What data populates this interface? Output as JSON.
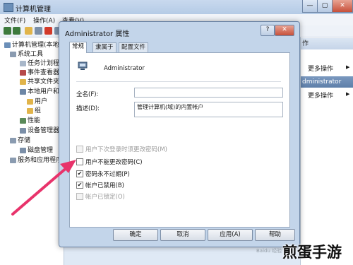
{
  "window": {
    "title": "计算机管理",
    "controls": {
      "minimize": "—",
      "maximize": "▢",
      "close": "✕"
    }
  },
  "menubar": {
    "items": [
      "文件(F)",
      "操作(A)",
      "查看(V)"
    ]
  },
  "tree": {
    "items": [
      {
        "label": "计算机管理(本地)"
      },
      {
        "label": "系统工具"
      },
      {
        "label": "任务计划程序"
      },
      {
        "label": "事件查看器"
      },
      {
        "label": "共享文件夹"
      },
      {
        "label": "本地用户和组"
      },
      {
        "label": "用户"
      },
      {
        "label": "组"
      },
      {
        "label": "性能"
      },
      {
        "label": "设备管理器"
      },
      {
        "label": "存储"
      },
      {
        "label": "磁盘管理"
      },
      {
        "label": "服务和应用程序"
      }
    ]
  },
  "actions": {
    "header1": "作",
    "more1": "更多操作",
    "header2": "dministrator",
    "more2": "更多操作"
  },
  "dialog": {
    "title": "Administrator 属性",
    "help_button": "?",
    "close_button": "✕",
    "tabs": [
      "常规",
      "隶属于",
      "配置文件"
    ],
    "username": "Administrator",
    "fullname_label": "全名(F):",
    "fullname_value": "",
    "description_label": "描述(D):",
    "description_value": "管理计算机(域)的内置帐户",
    "checkboxes": [
      {
        "label": "用户下次登录时须更改密码(M)",
        "checked": false,
        "disabled": true
      },
      {
        "label": "用户不能更改密码(C)",
        "checked": false,
        "disabled": false
      },
      {
        "label": "密码永不过期(P)",
        "checked": true,
        "disabled": false
      },
      {
        "label": "帐户已禁用(B)",
        "checked": true,
        "disabled": false
      },
      {
        "label": "帐户已锁定(O)",
        "checked": false,
        "disabled": true
      }
    ],
    "buttons": {
      "ok": "确定",
      "cancel": "取消",
      "apply": "应用(A)",
      "help": "帮助"
    }
  },
  "watermark": {
    "small": "Baidu 经验",
    "big": "煎蛋手游"
  },
  "colors": {
    "arrow": "#e8336b",
    "accent": "#5e7fa9"
  }
}
